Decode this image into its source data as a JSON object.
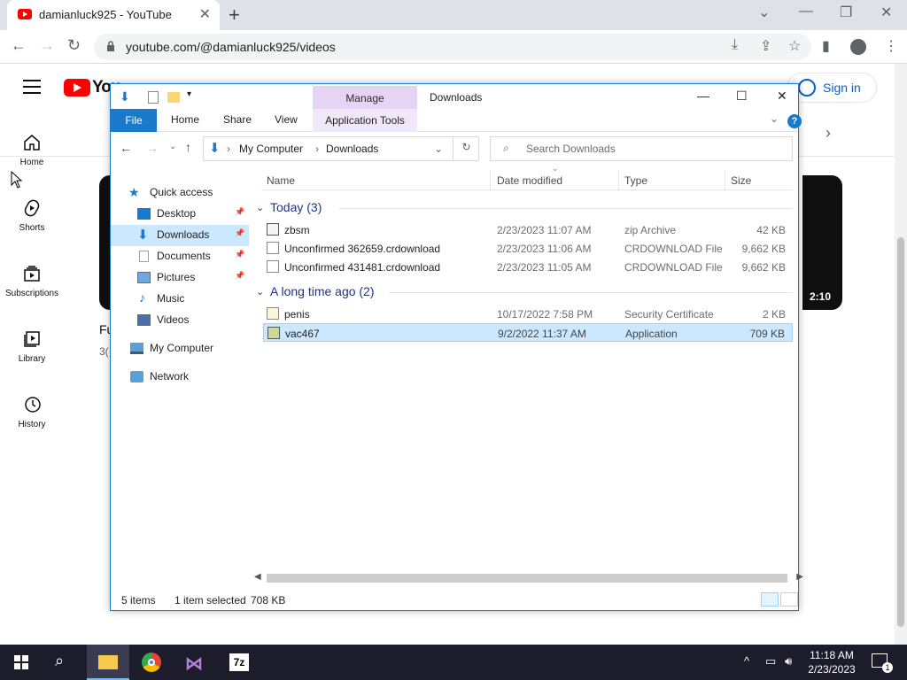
{
  "browser": {
    "tab_title": "damianluck925 - YouTube",
    "url": "youtube.com/@damianluck925/videos"
  },
  "youtube": {
    "logo_text": "You",
    "sign_in": "Sign in",
    "sidebar": [
      {
        "label": "Home",
        "icon": "home-icon"
      },
      {
        "label": "Shorts",
        "icon": "shorts-icon"
      },
      {
        "label": "Subscriptions",
        "icon": "subscriptions-icon"
      },
      {
        "label": "Library",
        "icon": "library-icon"
      },
      {
        "label": "History",
        "icon": "history-icon"
      }
    ],
    "video": {
      "title_fragment": "Fu",
      "meta_fragment": "3(",
      "duration": "2:10"
    }
  },
  "explorer": {
    "window_title": "Downloads",
    "manage_label": "Manage",
    "ribbon_tabs": [
      "File",
      "Home",
      "Share",
      "View"
    ],
    "app_tools": "Application Tools",
    "breadcrumb": [
      "My Computer",
      "Downloads"
    ],
    "search_placeholder": "Search Downloads",
    "nav": [
      {
        "label": "Quick access",
        "icon": "star-icon",
        "pinned": false
      },
      {
        "label": "Desktop",
        "icon": "desktop-icon",
        "pinned": true
      },
      {
        "label": "Downloads",
        "icon": "download-icon",
        "pinned": true,
        "selected": true
      },
      {
        "label": "Documents",
        "icon": "documents-icon",
        "pinned": true
      },
      {
        "label": "Pictures",
        "icon": "pictures-icon",
        "pinned": true
      },
      {
        "label": "Music",
        "icon": "music-icon",
        "pinned": false
      },
      {
        "label": "Videos",
        "icon": "videos-icon",
        "pinned": false
      },
      {
        "label": "My Computer",
        "icon": "computer-icon",
        "pinned": false
      },
      {
        "label": "Network",
        "icon": "network-icon",
        "pinned": false
      }
    ],
    "columns": [
      "Name",
      "Date modified",
      "Type",
      "Size"
    ],
    "groups": [
      {
        "label": "Today (3)",
        "files": [
          {
            "name": "zbsm",
            "date": "2/23/2023 11:07 AM",
            "type": "zip Archive",
            "size": "42 KB",
            "icon": "zip-icon"
          },
          {
            "name": "Unconfirmed 362659.crdownload",
            "date": "2/23/2023 11:06 AM",
            "type": "CRDOWNLOAD File",
            "size": "9,662 KB",
            "icon": "file-icon"
          },
          {
            "name": "Unconfirmed 431481.crdownload",
            "date": "2/23/2023 11:05 AM",
            "type": "CRDOWNLOAD File",
            "size": "9,662 KB",
            "icon": "file-icon"
          }
        ]
      },
      {
        "label": "A long time ago (2)",
        "files": [
          {
            "name": "penis",
            "date": "10/17/2022 7:58 PM",
            "type": "Security Certificate",
            "size": "2 KB",
            "icon": "certificate-icon"
          },
          {
            "name": "vac467",
            "date": "9/2/2022 11:37 AM",
            "type": "Application",
            "size": "709 KB",
            "icon": "application-icon",
            "selected": true
          }
        ]
      }
    ],
    "status": {
      "items": "5 items",
      "selected": "1 item selected",
      "size": "708 KB"
    }
  },
  "taskbar": {
    "time": "11:18 AM",
    "date": "2/23/2023",
    "notification_count": "1",
    "apps": [
      "file-explorer-icon",
      "chrome-icon",
      "visual-studio-icon",
      "7zip-icon"
    ]
  },
  "colors": {
    "accent": "#1979ca",
    "selection": "#cce8ff",
    "youtube_red": "#ff0000",
    "group_header": "#1e3287"
  }
}
